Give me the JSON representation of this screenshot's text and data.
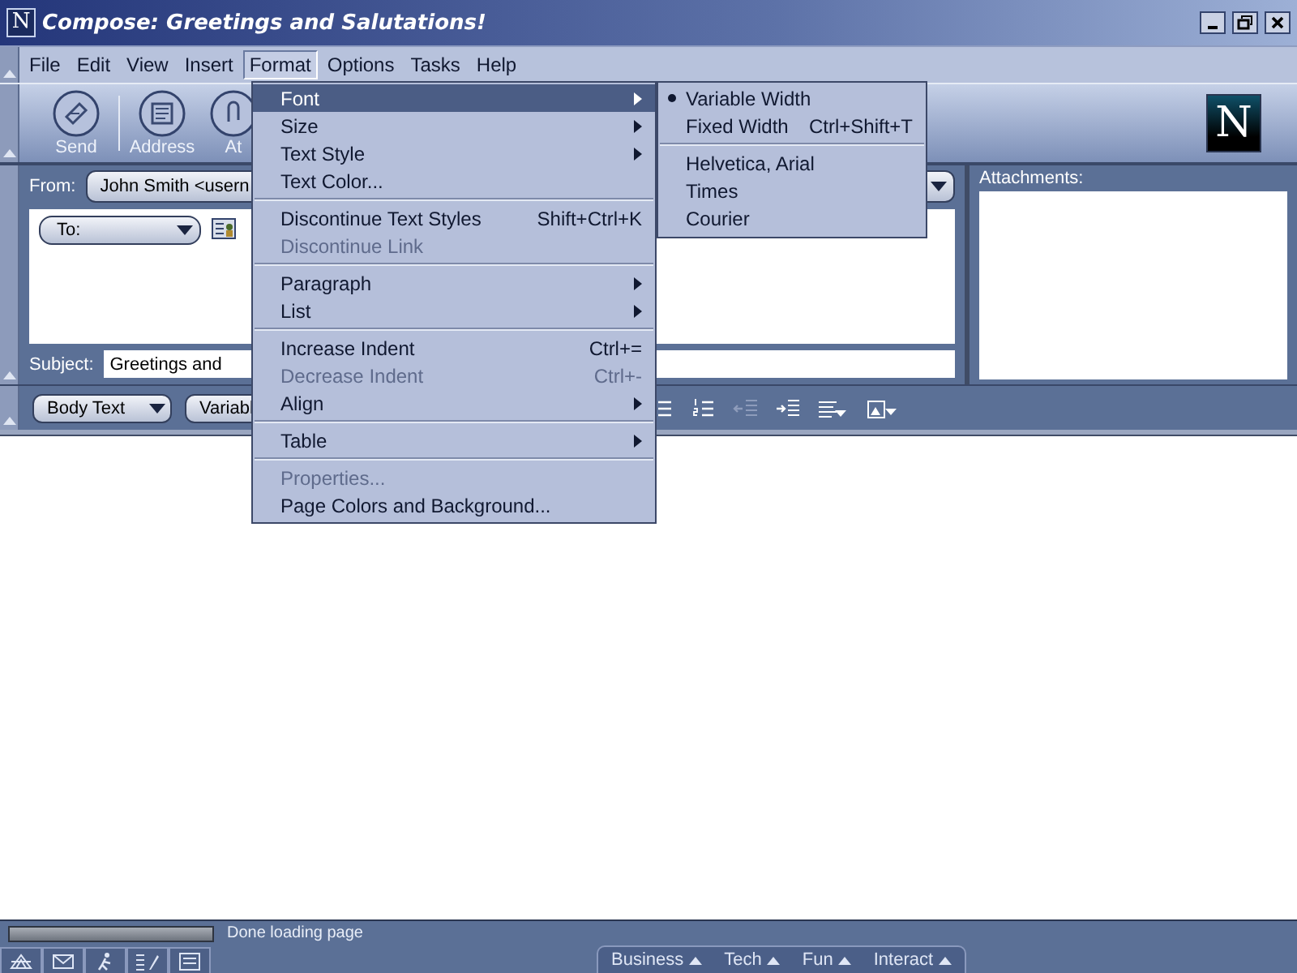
{
  "window": {
    "title": "Compose: Greetings and Salutations!",
    "logo": "N"
  },
  "brand_logo": "N",
  "menubar": [
    {
      "label": "File",
      "selected": false
    },
    {
      "label": "Edit",
      "selected": false
    },
    {
      "label": "View",
      "selected": false
    },
    {
      "label": "Insert",
      "selected": false
    },
    {
      "label": "Format",
      "selected": true
    },
    {
      "label": "Options",
      "selected": false
    },
    {
      "label": "Tasks",
      "selected": false
    },
    {
      "label": "Help",
      "selected": false
    }
  ],
  "toolbar": [
    {
      "label": "Send",
      "kind": "send"
    },
    {
      "label": "Address",
      "kind": "address"
    },
    {
      "label": "At",
      "kind": "attach"
    }
  ],
  "header": {
    "from_label": "From:",
    "from_value": "John Smith <usern",
    "to_label": "To:",
    "subject_label": "Subject:",
    "subject_value": "Greetings and",
    "attachments_label": "Attachments:"
  },
  "format_toolbar": {
    "paragraph_style": "Body Text",
    "font": "Variabl",
    "buttons": [
      {
        "kind": "bullets",
        "disabled": false
      },
      {
        "kind": "numbers",
        "disabled": false
      },
      {
        "kind": "outdent",
        "disabled": true
      },
      {
        "kind": "indent",
        "disabled": false
      },
      {
        "kind": "align",
        "disabled": false
      },
      {
        "kind": "insert",
        "disabled": false
      }
    ]
  },
  "format_menu": [
    {
      "kind": "item",
      "label": "Font",
      "submenu": true,
      "selected": true,
      "disabled": false
    },
    {
      "kind": "item",
      "label": "Size",
      "submenu": true,
      "selected": false,
      "disabled": false
    },
    {
      "kind": "item",
      "label": "Text Style",
      "submenu": true,
      "selected": false,
      "disabled": false
    },
    {
      "kind": "item",
      "label": "Text Color...",
      "submenu": false,
      "selected": false,
      "disabled": false
    },
    {
      "kind": "separator"
    },
    {
      "kind": "item",
      "label": "Discontinue Text Styles",
      "shortcut": "Shift+Ctrl+K",
      "submenu": false,
      "selected": false,
      "disabled": false
    },
    {
      "kind": "item",
      "label": "Discontinue Link",
      "submenu": false,
      "selected": false,
      "disabled": true
    },
    {
      "kind": "separator"
    },
    {
      "kind": "item",
      "label": "Paragraph",
      "submenu": true,
      "selected": false,
      "disabled": false
    },
    {
      "kind": "item",
      "label": "List",
      "submenu": true,
      "selected": false,
      "disabled": false
    },
    {
      "kind": "separator"
    },
    {
      "kind": "item",
      "label": "Increase Indent",
      "shortcut": "Ctrl+=",
      "submenu": false,
      "selected": false,
      "disabled": false
    },
    {
      "kind": "item",
      "label": "Decrease Indent",
      "shortcut": "Ctrl+-",
      "submenu": false,
      "selected": false,
      "disabled": true
    },
    {
      "kind": "item",
      "label": "Align",
      "submenu": true,
      "selected": false,
      "disabled": false
    },
    {
      "kind": "separator"
    },
    {
      "kind": "item",
      "label": "Table",
      "submenu": true,
      "selected": false,
      "disabled": false
    },
    {
      "kind": "separator"
    },
    {
      "kind": "item",
      "label": "Properties...",
      "submenu": false,
      "selected": false,
      "disabled": true
    },
    {
      "kind": "item",
      "label": "Page Colors and Background...",
      "submenu": false,
      "selected": false,
      "disabled": false
    }
  ],
  "font_submenu": [
    {
      "kind": "item",
      "label": "Variable Width",
      "checked": true
    },
    {
      "kind": "item",
      "label": "Fixed Width",
      "shortcut": "Ctrl+Shift+T",
      "checked": false
    },
    {
      "kind": "separator"
    },
    {
      "kind": "item",
      "label": "Helvetica, Arial",
      "checked": false
    },
    {
      "kind": "item",
      "label": "Times",
      "checked": false
    },
    {
      "kind": "item",
      "label": "Courier",
      "checked": false
    }
  ],
  "status_bar": {
    "text": "Done loading page"
  },
  "bottom_tabs": [
    "Business",
    "Tech",
    "Fun",
    "Interact"
  ]
}
